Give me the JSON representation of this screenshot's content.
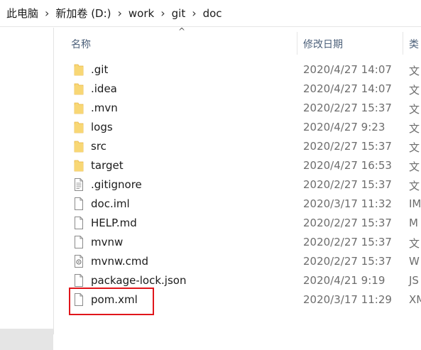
{
  "breadcrumb": [
    "此电脑",
    "新加卷 (D:)",
    "work",
    "git",
    "doc"
  ],
  "columns": {
    "name": "名称",
    "date": "修改日期",
    "type": "类"
  },
  "files": [
    {
      "name": ".git",
      "date": "2020/4/27 14:07",
      "type": "文",
      "icon": "folder-icon"
    },
    {
      "name": ".idea",
      "date": "2020/4/27 14:07",
      "type": "文",
      "icon": "folder-icon"
    },
    {
      "name": ".mvn",
      "date": "2020/2/27 15:37",
      "type": "文",
      "icon": "folder-icon"
    },
    {
      "name": "logs",
      "date": "2020/4/27 9:23",
      "type": "文",
      "icon": "folder-icon"
    },
    {
      "name": "src",
      "date": "2020/2/27 15:37",
      "type": "文",
      "icon": "folder-icon"
    },
    {
      "name": "target",
      "date": "2020/4/27 16:53",
      "type": "文",
      "icon": "folder-icon"
    },
    {
      "name": ".gitignore",
      "date": "2020/2/27 15:37",
      "type": "文",
      "icon": "text-file-icon"
    },
    {
      "name": "doc.iml",
      "date": "2020/3/17 11:32",
      "type": "IM",
      "icon": "file-icon"
    },
    {
      "name": "HELP.md",
      "date": "2020/2/27 15:37",
      "type": "M",
      "icon": "file-icon"
    },
    {
      "name": "mvnw",
      "date": "2020/2/27 15:37",
      "type": "文",
      "icon": "file-icon"
    },
    {
      "name": "mvnw.cmd",
      "date": "2020/2/27 15:37",
      "type": "W",
      "icon": "script-file-icon"
    },
    {
      "name": "package-lock.json",
      "date": "2020/4/21 9:19",
      "type": "JS",
      "icon": "file-icon"
    },
    {
      "name": "pom.xml",
      "date": "2020/3/17 11:29",
      "type": "XM",
      "icon": "file-icon"
    }
  ],
  "colors": {
    "folder": "#f8d775",
    "folder_dark": "#e6b543",
    "highlight": "#e0161b"
  }
}
